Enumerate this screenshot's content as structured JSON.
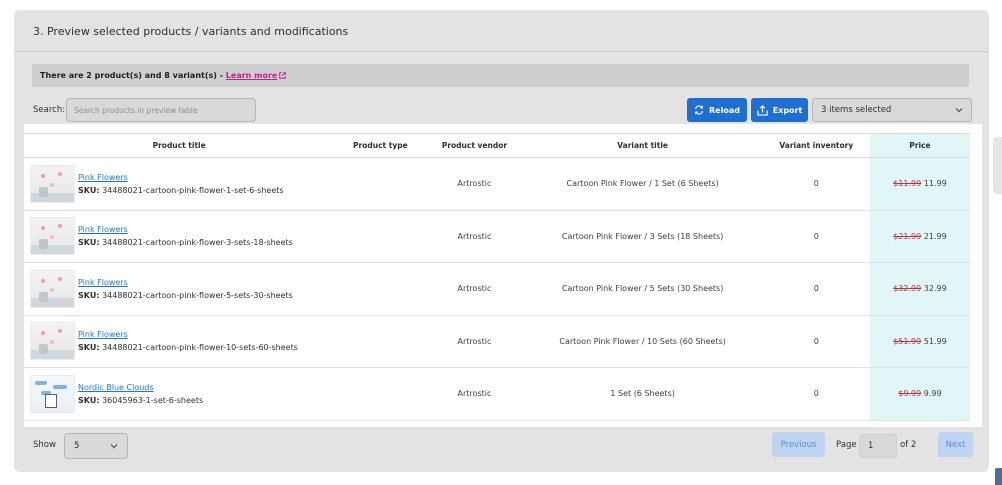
{
  "section": {
    "title": "3. Preview selected products / variants and modifications"
  },
  "banner": {
    "text": "There are 2 product(s) and 8 variant(s) - ",
    "link": "Learn more"
  },
  "search": {
    "label": "Search:",
    "placeholder": "Search products in preview table"
  },
  "toolbar": {
    "reload_label": "Reload",
    "export_label": "Export",
    "selected_label": "3 items selected"
  },
  "table": {
    "headers": {
      "title": "Product title",
      "type": "Product type",
      "vendor": "Product vendor",
      "variant": "Variant title",
      "inventory": "Variant inventory",
      "price": "Price"
    },
    "rows": [
      {
        "title": "Pink Flowers",
        "sku_label": "SKU:",
        "sku": "34488021-cartoon-pink-flower-1-set-6-sheets",
        "type": "",
        "vendor": "Artrostic",
        "variant": "Cartoon Pink Flower / 1 Set (6 Sheets)",
        "inventory": "0",
        "old_price": "$11.99",
        "new_price": "11.99"
      },
      {
        "title": "Pink Flowers",
        "sku_label": "SKU:",
        "sku": "34488021-cartoon-pink-flower-3-sets-18-sheets",
        "type": "",
        "vendor": "Artrostic",
        "variant": "Cartoon Pink Flower / 3 Sets (18 Sheets)",
        "inventory": "0",
        "old_price": "$21.99",
        "new_price": "21.99"
      },
      {
        "title": "Pink Flowers",
        "sku_label": "SKU:",
        "sku": "34488021-cartoon-pink-flower-5-sets-30-sheets",
        "type": "",
        "vendor": "Artrostic",
        "variant": "Cartoon Pink Flower / 5 Sets (30 Sheets)",
        "inventory": "0",
        "old_price": "$32.99",
        "new_price": "32.99"
      },
      {
        "title": "Pink Flowers",
        "sku_label": "SKU:",
        "sku": "34488021-cartoon-pink-flower-10-sets-60-sheets",
        "type": "",
        "vendor": "Artrostic",
        "variant": "Cartoon Pink Flower / 10 Sets (60 Sheets)",
        "inventory": "0",
        "old_price": "$51.99",
        "new_price": "51.99"
      },
      {
        "title": "Nordic Blue Clouds",
        "sku_label": "SKU:",
        "sku": "36045963-1-set-6-sheets",
        "type": "",
        "vendor": "Artrostic",
        "variant": "1 Set (6 Sheets)",
        "inventory": "0",
        "old_price": "$9.99",
        "new_price": "9.99"
      }
    ]
  },
  "pagination": {
    "show_label": "Show",
    "page_size": "5",
    "prev_label": "Previous",
    "page_label": "Page",
    "current_page": "1",
    "of_label": "of 2",
    "next_label": "Next"
  },
  "colors": {
    "accent": "#1f6fd1",
    "link": "#1f74d8",
    "price_highlight": "#e1f7f7",
    "old_price": "#c0303a"
  }
}
